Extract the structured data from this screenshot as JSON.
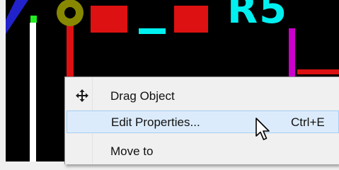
{
  "pcb": {
    "refdes_text": "R5",
    "colors": {
      "background": "#000000",
      "pad_red": "#dd1111",
      "via_ring": "#888800",
      "silk_cyan": "#00f0f0",
      "track_white": "#ffffff",
      "track_magenta": "#cc00cc",
      "marker_green": "#22ee22",
      "edge_blue": "#2222cc"
    }
  },
  "context_menu": {
    "items": [
      {
        "label": "Drag Object",
        "icon": "move-arrows-icon",
        "shortcut": ""
      },
      {
        "label": "Edit Properties...",
        "shortcut": "Ctrl+E",
        "highlighted": true
      },
      {
        "label": "Move to",
        "shortcut": ""
      }
    ]
  },
  "cursor": {
    "icon": "mouse-pointer-icon"
  }
}
